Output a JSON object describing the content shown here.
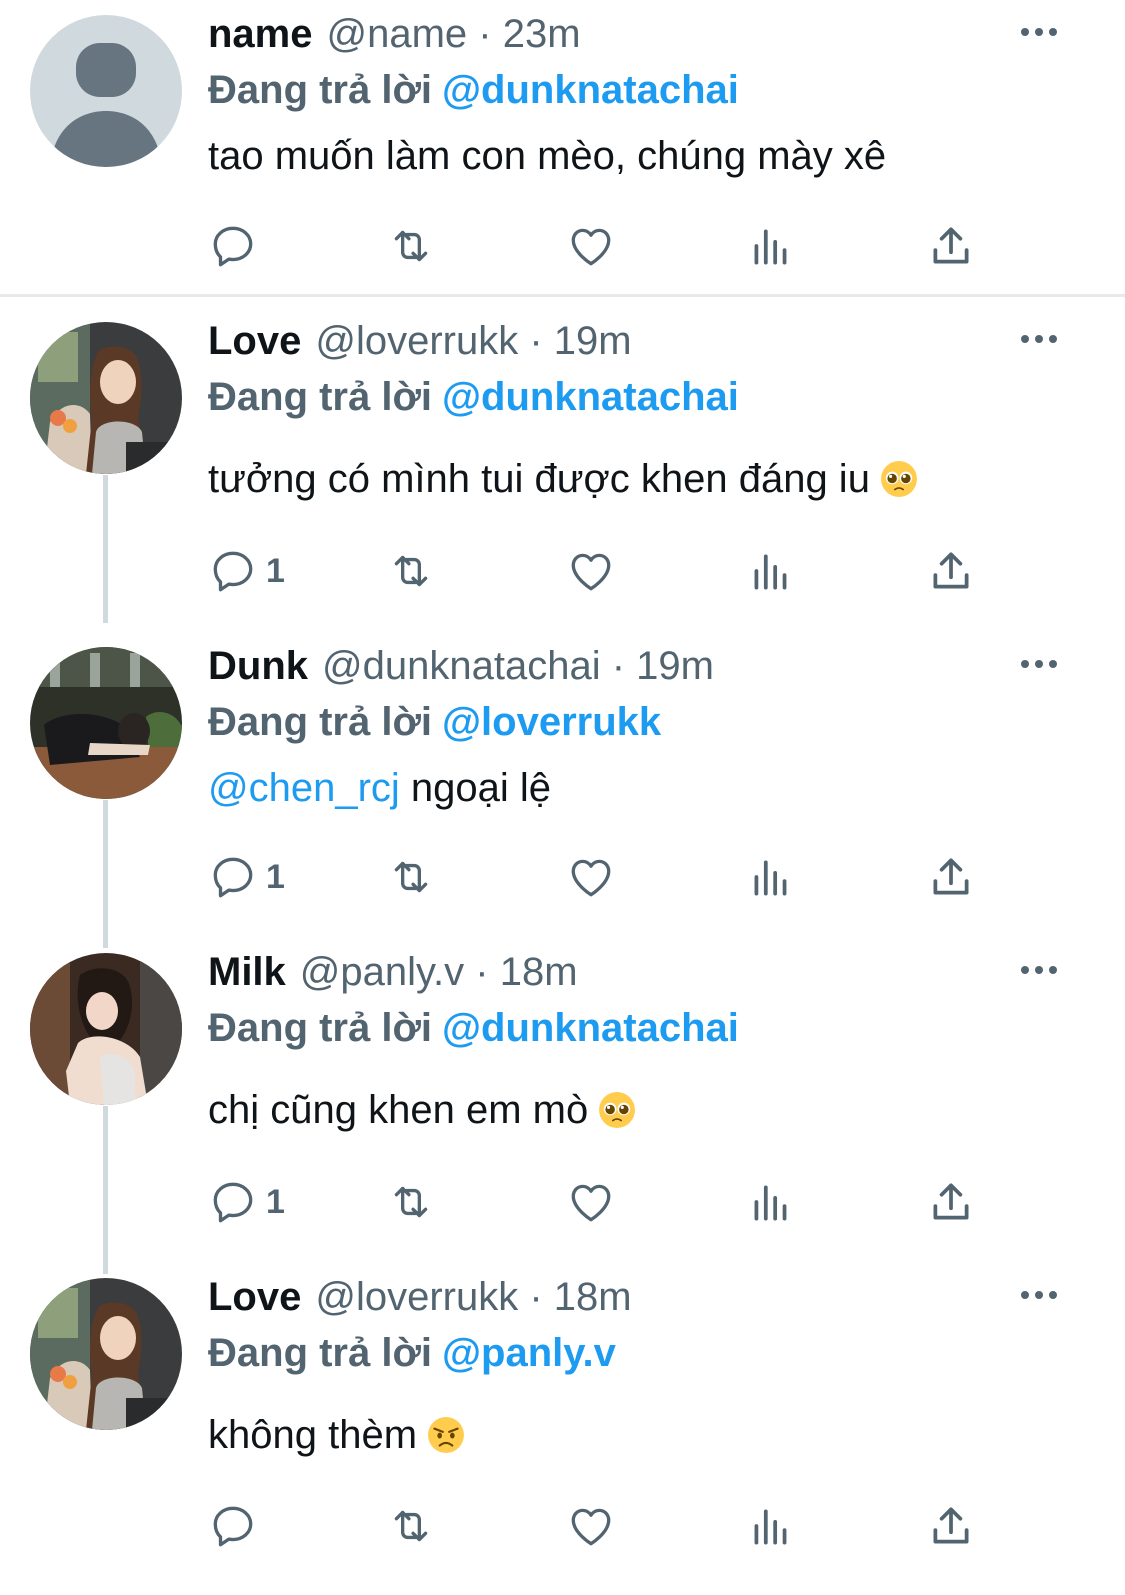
{
  "colors": {
    "accent": "#1d9bf0",
    "secondary_text": "#536471",
    "primary_text": "#0f1419",
    "thread_line": "#cfd9de"
  },
  "tweets": [
    {
      "name": "name",
      "handle_time": "@name · 23m",
      "reply_prefix": "Đang trả lời",
      "reply_to": "@dunknatachai",
      "text": "tao muốn làm con mèo, chúng mày xê",
      "reply_count": "",
      "avatar": "default-avatar-icon"
    },
    {
      "name": "Love",
      "handle_time": "@loverrukk · 19m",
      "reply_prefix": "Đang trả lời",
      "reply_to": "@dunknatachai",
      "text": "tưởng có mình tui được khen đáng iu",
      "emoji": "pleading-face-emoji",
      "reply_count": "1",
      "avatar": "photo-avatar"
    },
    {
      "name": "Dunk",
      "handle_time": "@dunknatachai · 19m",
      "reply_prefix": "Đang trả lời",
      "reply_to": "@loverrukk",
      "mention": "@chen_rcj",
      "text": "ngoại lệ",
      "reply_count": "1",
      "avatar": "photo-avatar"
    },
    {
      "name": "Milk",
      "handle_time": "@panly.v · 18m",
      "reply_prefix": "Đang trả lời",
      "reply_to": "@dunknatachai",
      "text": "chị cũng khen em mò",
      "emoji": "pleading-face-emoji",
      "reply_count": "1",
      "avatar": "photo-avatar"
    },
    {
      "name": "Love",
      "handle_time": "@loverrukk · 18m",
      "reply_prefix": "Đang trả lời",
      "reply_to": "@panly.v",
      "text": "không thèm",
      "emoji": "angry-face-emoji",
      "reply_count": "",
      "avatar": "photo-avatar"
    }
  ]
}
